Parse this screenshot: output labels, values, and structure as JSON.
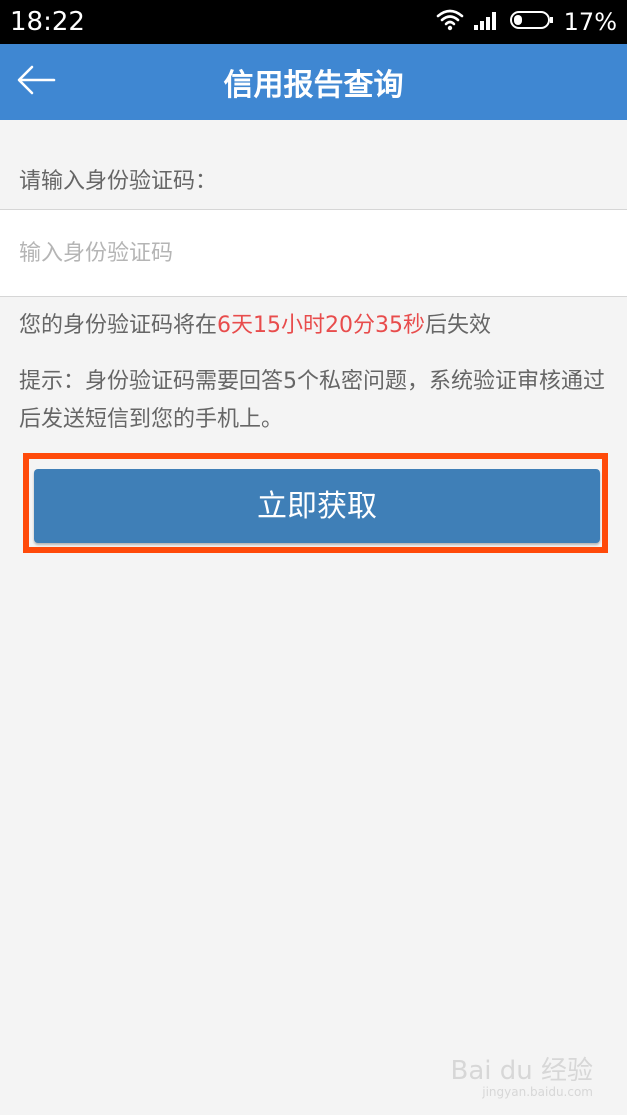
{
  "status_bar": {
    "time": "18:22",
    "battery": "17%",
    "icons": [
      "wifi-icon",
      "signal-icon",
      "battery-icon"
    ]
  },
  "app_bar": {
    "title": "信用报告查询",
    "back_icon": "back-arrow-icon",
    "color": "#3f87d2"
  },
  "form": {
    "label": "请输入身份验证码：",
    "input_placeholder": "输入身份验证码",
    "input_value": ""
  },
  "expiry": {
    "prefix": "您的身份验证码将在",
    "highlight": "6天15小时20分35秒",
    "suffix": "后失效",
    "highlight_color": "#e84c4c"
  },
  "hint": {
    "text": "提示：身份验证码需要回答5个私密问题，系统验证审核通过后发送短信到您的手机上。"
  },
  "action": {
    "button_label": "立即获取",
    "button_color": "#3f7fb7",
    "highlight_color": "#ff4a0a"
  },
  "watermark": {
    "text": "Bai du 经验",
    "sub": "jingyan.baidu.com"
  }
}
